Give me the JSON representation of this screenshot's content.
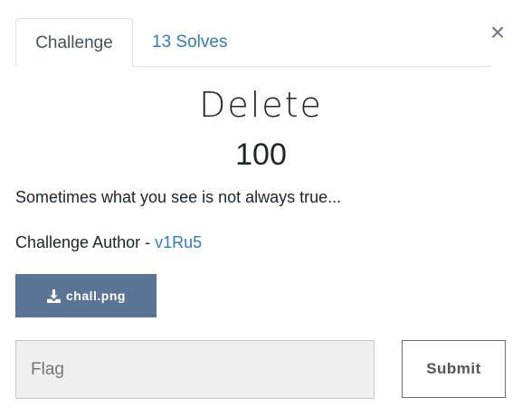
{
  "tabs": {
    "challenge_label": "Challenge",
    "solves_label": "13 Solves"
  },
  "close_label": "×",
  "challenge": {
    "name": "Delete",
    "value": "100",
    "description": "Sometimes what you see is not always true...",
    "author_prefix": "Challenge Author - ",
    "author_name": "v1Ru5"
  },
  "file": {
    "icon": "download-icon",
    "label": "chall.png"
  },
  "submission": {
    "placeholder": "Flag",
    "value": "",
    "submit_label": "Submit"
  },
  "colors": {
    "link": "#337ab7",
    "file_button": "#5b7395",
    "input_background": "#efefef"
  }
}
